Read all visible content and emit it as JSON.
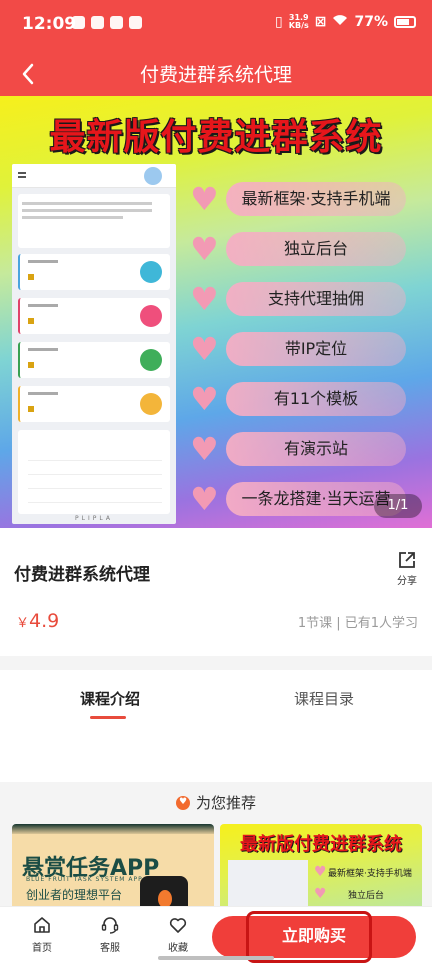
{
  "status_bar": {
    "time": "12:09",
    "net_speed_top": "31.9",
    "net_speed_bottom": "KB/s",
    "battery": "77%"
  },
  "nav": {
    "title": "付费进群系统代理"
  },
  "banner": {
    "headline": "最新版付费进群系统",
    "features": [
      "最新框架·支持手机端",
      "独立后台",
      "支持代理抽佣",
      "带IP定位",
      "有11个模板",
      "有演示站",
      "一条龙搭建·当天运营"
    ],
    "page_indicator": "1/1"
  },
  "product": {
    "title": "付费进群系统代理",
    "share_label": "分享",
    "currency": "￥",
    "price": "4.9",
    "meta": "1节课 | 已有1人学习"
  },
  "tabs": {
    "intro": "课程介绍",
    "catalog": "课程目录"
  },
  "recommend": {
    "title": "为您推荐",
    "cards": [
      {
        "title": "悬赏任务APP",
        "subtitle_en": "BLUE FRUIT TASK SYSTEM APP",
        "tagline": "创业者的理想平台"
      },
      {
        "title": "最新版付费进群系统",
        "line1": "最新框架·支持手机端",
        "line2": "独立后台"
      }
    ]
  },
  "bottom_bar": {
    "home": "首页",
    "service": "客服",
    "favorite": "收藏",
    "buy": "立即购买"
  },
  "colors": {
    "brand_red": "#f24a47",
    "price_red": "#e84b3c",
    "heart_pink": "#f29ab4"
  }
}
